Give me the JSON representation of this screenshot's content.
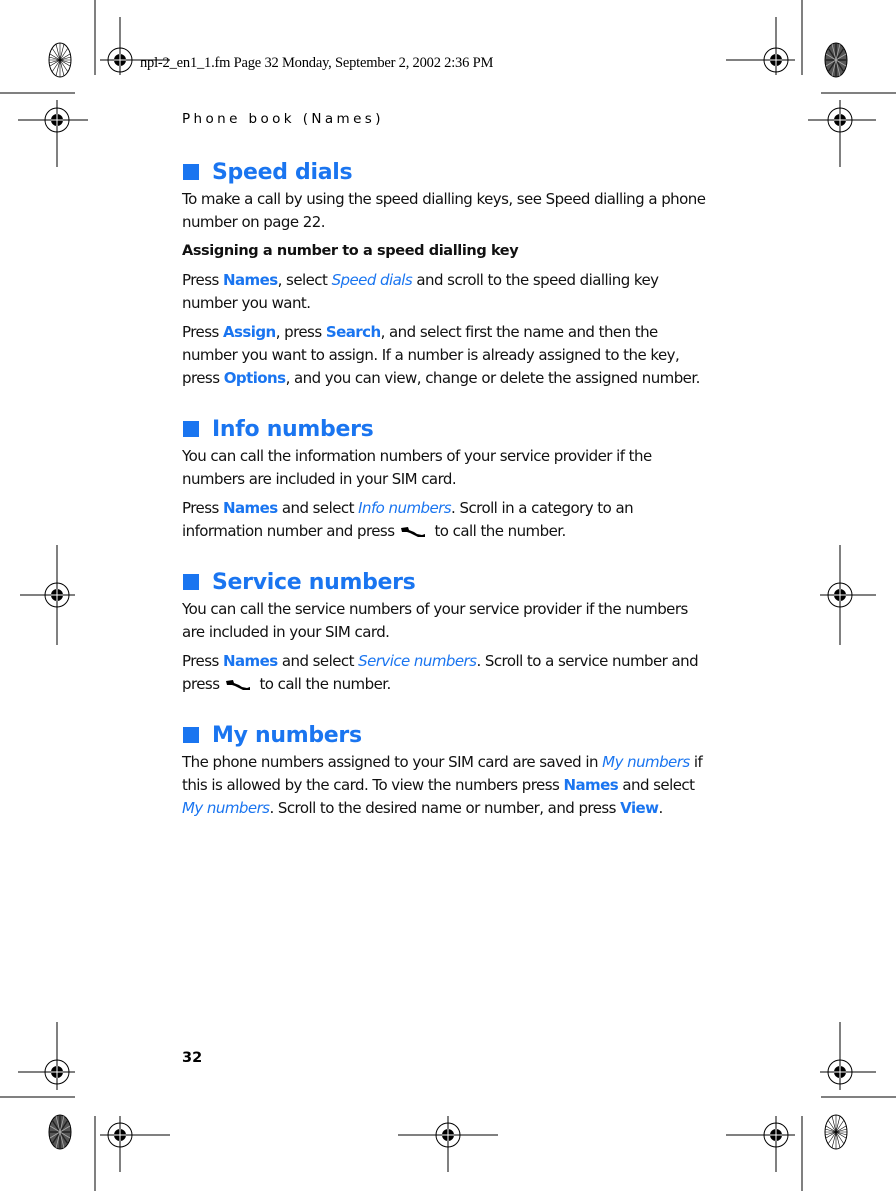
{
  "slug": "npl-2_en1_1.fm  Page 32  Monday, September 2, 2002  2:36 PM",
  "running_head": "Phone book (Names)",
  "page_number": "32",
  "accent_color": "#1a75f0",
  "sections": [
    {
      "title": "Speed dials",
      "intro": "To make a call by using the speed dialling keys, see Speed dialling a phone number on page 22.",
      "subheading": "Assigning a number to a speed dialling key",
      "p1": {
        "a": "Press ",
        "k1": "Names",
        "b": ", select ",
        "i1": "Speed dials",
        "c": " and scroll to the speed dialling key number you want."
      },
      "p2": {
        "a": "Press ",
        "k1": "Assign",
        "b": ", press ",
        "k2": "Search",
        "c": ", and select first the name and then the number you want to assign. If a number is already assigned to the key, press ",
        "k3": "Options",
        "d": ", and you can view, change or delete the assigned number."
      }
    },
    {
      "title": "Info numbers",
      "intro": "You can call the information numbers of your service provider if the numbers are included in your SIM  card.",
      "p1": {
        "a": "Press ",
        "k1": "Names",
        "b": " and select ",
        "i1": "Info numbers",
        "c": ". Scroll in a category to an information number and press",
        "icon": "call-key-icon",
        "d": "to call the number."
      }
    },
    {
      "title": "Service numbers",
      "intro": "You can call the service numbers of your service provider if the numbers are included in your SIM  card.",
      "p1": {
        "a": "Press ",
        "k1": "Names",
        "b": " and select ",
        "i1": "Service numbers",
        "c": ". Scroll to a service number and press",
        "icon": "call-key-icon",
        "d": "to call the number."
      }
    },
    {
      "title": "My numbers",
      "p1": {
        "a": "The phone numbers assigned to your SIM  card are saved in ",
        "i1": "My numbers",
        "b": " if this is allowed by the card. To view the numbers press ",
        "k1": "Names",
        "c": " and select ",
        "i2": "My numbers",
        "d": ". Scroll to the desired name or number, and press ",
        "k2": "View",
        "e": "."
      }
    }
  ]
}
